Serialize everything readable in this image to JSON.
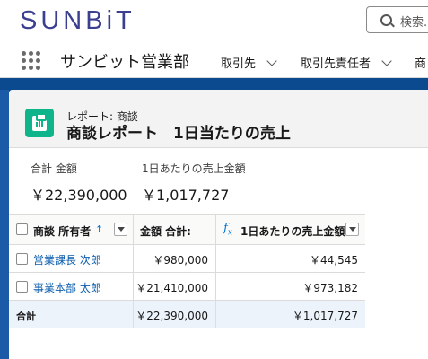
{
  "brand": {
    "logo_text": "SUNBiT"
  },
  "search": {
    "placeholder": "検索..."
  },
  "nav": {
    "app_name": "サンビット営業部",
    "items": [
      {
        "label": "取引先"
      },
      {
        "label": "取引先責任者"
      },
      {
        "label": "商"
      }
    ]
  },
  "report": {
    "subtitle": "レポート: 商談",
    "title": "商談レポート　1日当たりの売上"
  },
  "summary": [
    {
      "label": "合計 金額",
      "value": "￥22,390,000"
    },
    {
      "label": "1日あたりの売上金額",
      "value": "￥1,017,727"
    }
  ],
  "table": {
    "headers": {
      "owner": "商談 所有者",
      "owner_sort": "↑",
      "amount": "金額 合計:",
      "formula_icon": "fx",
      "daily": "1日あたりの売上金額"
    },
    "rows": [
      {
        "owner": "営業課長 次郎",
        "amount": "￥980,000",
        "daily": "￥44,545"
      },
      {
        "owner": "事業本部 太郎",
        "amount": "￥21,410,000",
        "daily": "￥973,182"
      }
    ],
    "total": {
      "label": "合計",
      "amount": "￥22,390,000",
      "daily": "￥1,017,727"
    }
  },
  "colors": {
    "band": "#0b4a8f",
    "report_icon": "#0eb58a",
    "link": "#0b5cab",
    "logo": "#3a3f8f"
  }
}
